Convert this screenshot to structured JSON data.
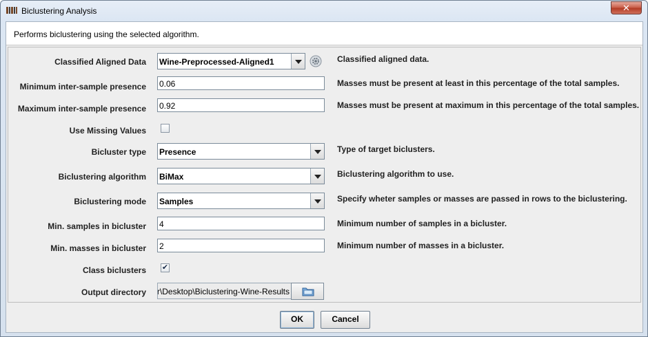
{
  "window": {
    "title": "Biclustering Analysis",
    "close_label": "✕"
  },
  "description": "Performs biclustering using the selected algorithm.",
  "fields": {
    "classified_data": {
      "label": "Classified Aligned Data",
      "value": "Wine-Preprocessed-Aligned1",
      "help": "Classified aligned data."
    },
    "min_presence": {
      "label": "Minimum inter-sample presence",
      "value": "0.06",
      "help": "Masses must be present at least in this percentage of the total samples."
    },
    "max_presence": {
      "label": "Maximum inter-sample presence",
      "value": "0.92",
      "help": "Masses must be present at maximum in this percentage of the total samples."
    },
    "missing_values": {
      "label": "Use Missing Values",
      "checked": false,
      "mark": ""
    },
    "bicluster_type": {
      "label": "Bicluster type",
      "value": "Presence",
      "help": "Type of target biclusters."
    },
    "algorithm": {
      "label": "Biclustering algorithm",
      "value": "BiMax",
      "help": "Biclustering algorithm to use."
    },
    "mode": {
      "label": "Biclustering mode",
      "value": "Samples",
      "help": "Specify wheter samples or masses are passed in rows to the biclustering."
    },
    "min_samples": {
      "label": "Min. samples in bicluster",
      "value": "4",
      "help": "Minimum number of samples in a bicluster."
    },
    "min_masses": {
      "label": "Min. masses in bicluster",
      "value": "2",
      "help": "Minimum number of masses in a bicluster."
    },
    "class_biclusters": {
      "label": "Class biclusters",
      "checked": true,
      "mark": "✔"
    },
    "output_dir": {
      "label": "Output directory",
      "value": "C:\\Users\\user\\Desktop\\Biclustering-Wine-Results"
    }
  },
  "buttons": {
    "ok": "OK",
    "cancel": "Cancel"
  },
  "icons": {
    "app": "app-icon",
    "gear": "gear-icon",
    "folder": "folder-icon",
    "close": "close-icon"
  }
}
